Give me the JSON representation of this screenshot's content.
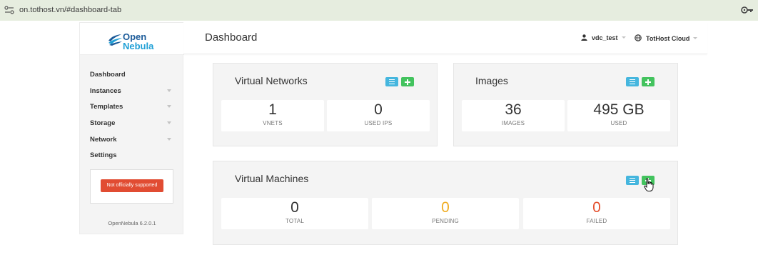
{
  "browser": {
    "url": "on.tothost.vn/#dashboard-tab"
  },
  "brand": {
    "line1": "Open",
    "line2": "Nebula"
  },
  "sidebar": {
    "items": [
      {
        "label": "Dashboard",
        "has_submenu": false
      },
      {
        "label": "Instances",
        "has_submenu": true
      },
      {
        "label": "Templates",
        "has_submenu": true
      },
      {
        "label": "Storage",
        "has_submenu": true
      },
      {
        "label": "Network",
        "has_submenu": true
      },
      {
        "label": "Settings",
        "has_submenu": false
      }
    ],
    "support_label": "Not officially supported",
    "version": "OpenNebula 6.2.0.1"
  },
  "header": {
    "title": "Dashboard",
    "user": "vdc_test",
    "zone": "TotHost Cloud"
  },
  "panels": {
    "virtual_networks": {
      "title": "Virtual Networks",
      "stats": [
        {
          "value": "1",
          "label": "VNETS"
        },
        {
          "value": "0",
          "label": "USED IPS"
        }
      ]
    },
    "images": {
      "title": "Images",
      "stats": [
        {
          "value": "36",
          "label": "IMAGES"
        },
        {
          "value": "495 GB",
          "label": "USED"
        }
      ]
    },
    "virtual_machines": {
      "title": "Virtual Machines",
      "stats": [
        {
          "value": "0",
          "label": "TOTAL"
        },
        {
          "value": "0",
          "label": "PENDING"
        },
        {
          "value": "0",
          "label": "FAILED"
        }
      ]
    }
  },
  "colors": {
    "list_button": "#45b6de",
    "add_button": "#43c35e",
    "pending": "#f0ad24",
    "failed": "#e4502e",
    "support_badge": "#e14c32"
  }
}
